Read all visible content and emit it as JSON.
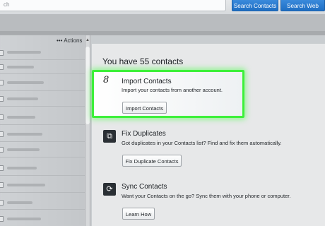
{
  "top": {
    "search_contacts": "Search Contacts",
    "search_web": "Search Web",
    "search_placeholder": "ch"
  },
  "left": {
    "actions_label": "Actions",
    "actions_dots": "•••",
    "caret": "⌄"
  },
  "main": {
    "heading": "You have 55 contacts",
    "import": {
      "icon": "8",
      "title": "Import Contacts",
      "desc": "Import your contacts from another account.",
      "button": "Import Contacts"
    },
    "duplicates": {
      "title": "Fix Duplicates",
      "desc": "Got duplicates in your Contacts list? Find and fix them automatically.",
      "button": "Fix Duplicate Contacts"
    },
    "sync": {
      "title": "Sync Contacts",
      "desc": "Want your Contacts on the go? Sync them with your phone or computer.",
      "button": "Learn How"
    }
  },
  "colors": {
    "highlight": "#3df03a",
    "accent": "#1f6fc4"
  }
}
